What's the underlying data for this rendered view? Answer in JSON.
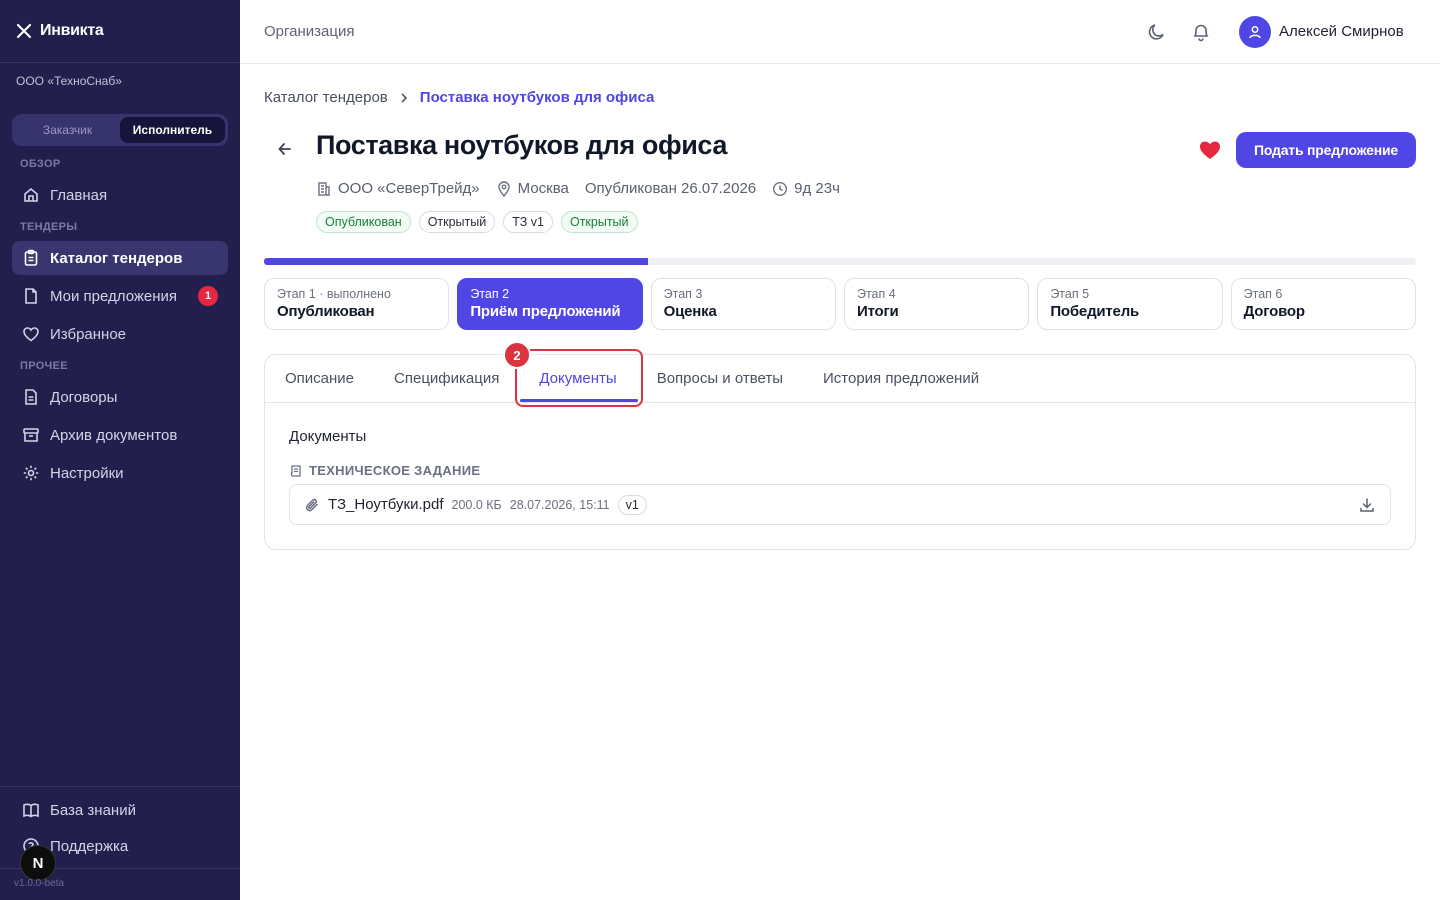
{
  "app": {
    "name": "Инвикта",
    "org": "ООО «ТехноСнаб»",
    "version": "v1.0.0-beta"
  },
  "roles": {
    "customer": "Заказчик",
    "executor": "Исполнитель",
    "active": "executor"
  },
  "sidebar": {
    "sections": {
      "overview": "ОБЗОР",
      "tenders": "ТЕНДЕРЫ",
      "other": "ПРОЧЕЕ"
    },
    "items": [
      {
        "label": "Главная",
        "icon": "home-icon"
      },
      {
        "label": "Каталог тендеров",
        "icon": "clipboard-icon",
        "active": true
      },
      {
        "label": "Мои предложения",
        "icon": "file-icon",
        "badge": "1"
      },
      {
        "label": "Избранное",
        "icon": "heart-icon"
      },
      {
        "label": "Договоры",
        "icon": "document-icon"
      },
      {
        "label": "Архив документов",
        "icon": "archive-icon"
      },
      {
        "label": "Настройки",
        "icon": "gear-icon"
      }
    ],
    "bottom": [
      {
        "label": "База знаний",
        "icon": "book-icon"
      },
      {
        "label": "Поддержка",
        "icon": "help-icon"
      }
    ],
    "dev_badge": "N"
  },
  "header": {
    "title": "Организация",
    "user_name": "Алексей Смирнов"
  },
  "breadcrumb": {
    "parent": "Каталог тендеров",
    "current": "Поставка ноутбуков для офиса"
  },
  "tender": {
    "title": "Поставка ноутбуков для офиса",
    "company": "ООО «СеверТрейд»",
    "city": "Москва",
    "published": "Опубликован 26.07.2026",
    "time_left": "9д 23ч",
    "tags": [
      "Опубликован",
      "Открытый",
      "ТЗ v1",
      "Открытый"
    ],
    "submit_label": "Подать предложение",
    "favorite": true,
    "progress_fraction": 0.333
  },
  "stages": [
    {
      "num": "Этап 1 · выполнено",
      "name": "Опубликован"
    },
    {
      "num": "Этап 2",
      "name": "Приём предложений",
      "active": true
    },
    {
      "num": "Этап 3",
      "name": "Оценка"
    },
    {
      "num": "Этап 4",
      "name": "Итоги"
    },
    {
      "num": "Этап 5",
      "name": "Победитель"
    },
    {
      "num": "Этап 6",
      "name": "Договор"
    }
  ],
  "tabs": [
    "Описание",
    "Спецификация",
    "Документы",
    "Вопросы и ответы",
    "История предложений"
  ],
  "active_tab": "Документы",
  "step_marker": "2",
  "documents": {
    "title": "Документы",
    "section": "ТЕХНИЧЕСКОЕ ЗАДАНИЕ",
    "files": [
      {
        "name": "ТЗ_Ноутбуки.pdf",
        "size": "200.0 КБ",
        "date": "28.07.2026, 15:11",
        "version": "v1"
      }
    ]
  },
  "colors": {
    "sidebar_bg": "#221f4d",
    "accent": "#4f46e5",
    "danger": "#e5283f",
    "success": "#16803c"
  }
}
